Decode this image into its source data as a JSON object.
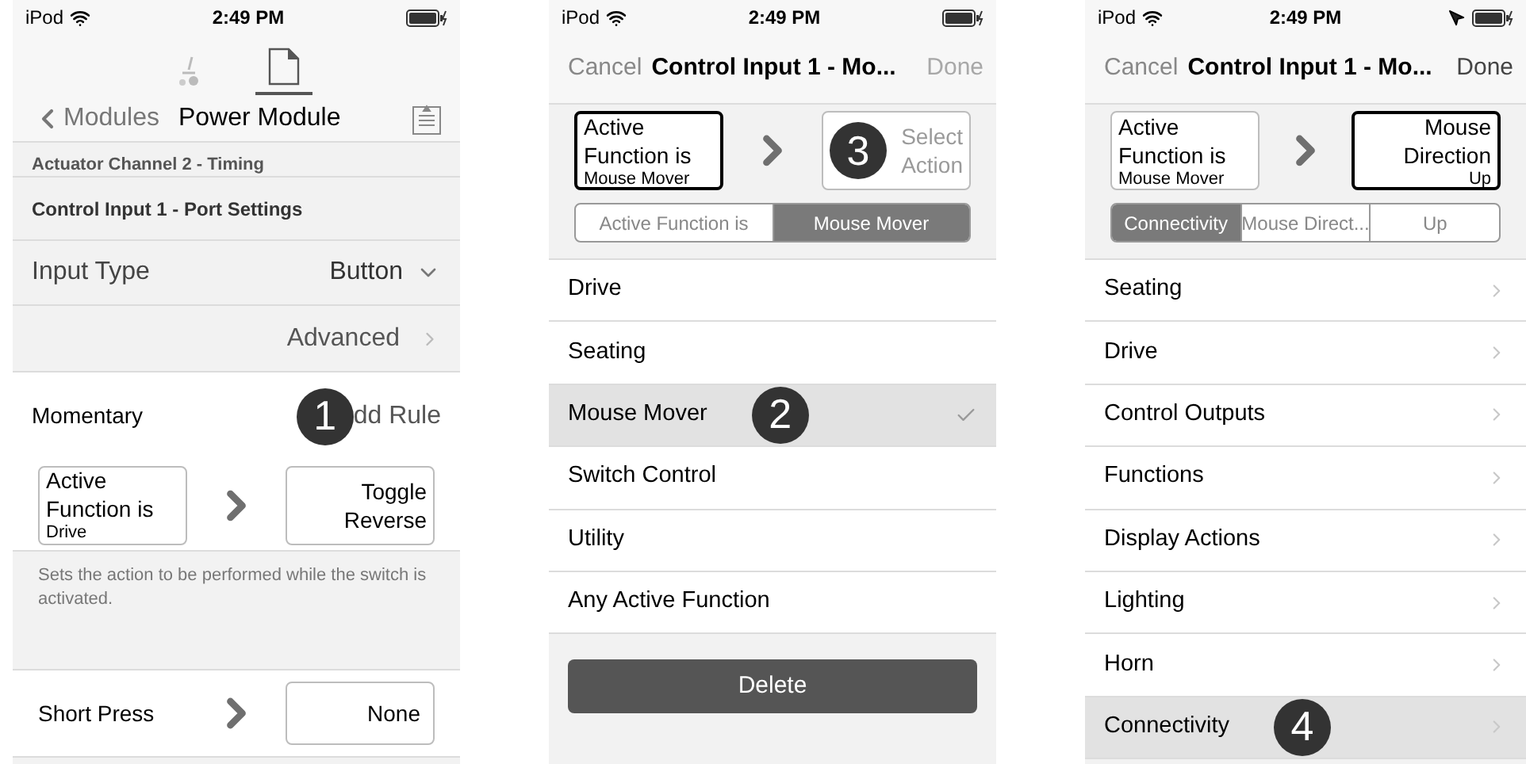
{
  "screen_1": {
    "status_bar": {
      "device": "iPod",
      "time": "2:49 PM"
    },
    "tabs": [
      {
        "kind": "wheelchair",
        "selected": false
      },
      {
        "kind": "document",
        "selected": true
      }
    ],
    "nav": {
      "back": "Modules",
      "title": "Power Module"
    },
    "partial_row": "Actuator Channel 2 - Timing",
    "section_header": "Control Input 1 - Port Settings",
    "input_type": {
      "label": "Input Type",
      "value": "Button"
    },
    "advanced": "Advanced",
    "momentary": {
      "label": "Momentary",
      "badge": "1",
      "action": "dd Rule"
    },
    "rule": {
      "condition": {
        "title": "Active Function is",
        "value": "Drive",
        "selected": false
      },
      "action": {
        "title": "Toggle Reverse",
        "selected": false,
        "dimmed": false
      }
    },
    "description": "Sets the action to be performed while the switch is activated.",
    "short_press": {
      "label": "Short Press",
      "action": "None"
    }
  },
  "screen_2": {
    "status_bar": {
      "device": "iPod",
      "time": "2:49 PM"
    },
    "nav": {
      "cancel": "Cancel",
      "title": "Control Input 1 - Mo...",
      "done": "Done",
      "done_disabled": true
    },
    "rule": {
      "condition": {
        "title": "Active Function is",
        "value": "Mouse Mover",
        "selected": true
      },
      "action": {
        "title": "Select Action",
        "selected": false,
        "dimmed": true,
        "badge": "3"
      }
    },
    "segments": [
      {
        "label": "Active Function is",
        "selected": false
      },
      {
        "label": "Mouse Mover",
        "selected": true
      }
    ],
    "list": [
      {
        "label": "Drive",
        "selected": false
      },
      {
        "label": "Seating",
        "selected": false
      },
      {
        "label": "Mouse Mover",
        "selected": true,
        "badge": "2"
      },
      {
        "label": "Switch Control",
        "selected": false
      },
      {
        "label": "Utility",
        "selected": false
      },
      {
        "label": "Any Active Function",
        "selected": false
      }
    ],
    "delete_button": "Delete"
  },
  "screen_3": {
    "status_bar": {
      "device": "iPod",
      "time": "2:49 PM",
      "location": true
    },
    "nav": {
      "cancel": "Cancel",
      "title": "Control Input 1 - Mo...",
      "done": "Done",
      "done_disabled": false
    },
    "rule": {
      "condition": {
        "title": "Active Function is",
        "value": "Mouse Mover",
        "selected": false
      },
      "action": {
        "title": "Mouse Direction",
        "value": "Up",
        "selected": true,
        "dimmed": false
      }
    },
    "segments": [
      {
        "label": "Connectivity",
        "selected": true
      },
      {
        "label": "Mouse Direct...",
        "selected": false
      },
      {
        "label": "Up",
        "selected": false
      }
    ],
    "list": [
      {
        "label": "Seating",
        "selected": false
      },
      {
        "label": "Drive",
        "selected": false
      },
      {
        "label": "Control Outputs",
        "selected": false
      },
      {
        "label": "Functions",
        "selected": false
      },
      {
        "label": "Display Actions",
        "selected": false
      },
      {
        "label": "Lighting",
        "selected": false
      },
      {
        "label": "Horn",
        "selected": false
      },
      {
        "label": "Connectivity",
        "selected": true,
        "badge": "4"
      }
    ]
  }
}
